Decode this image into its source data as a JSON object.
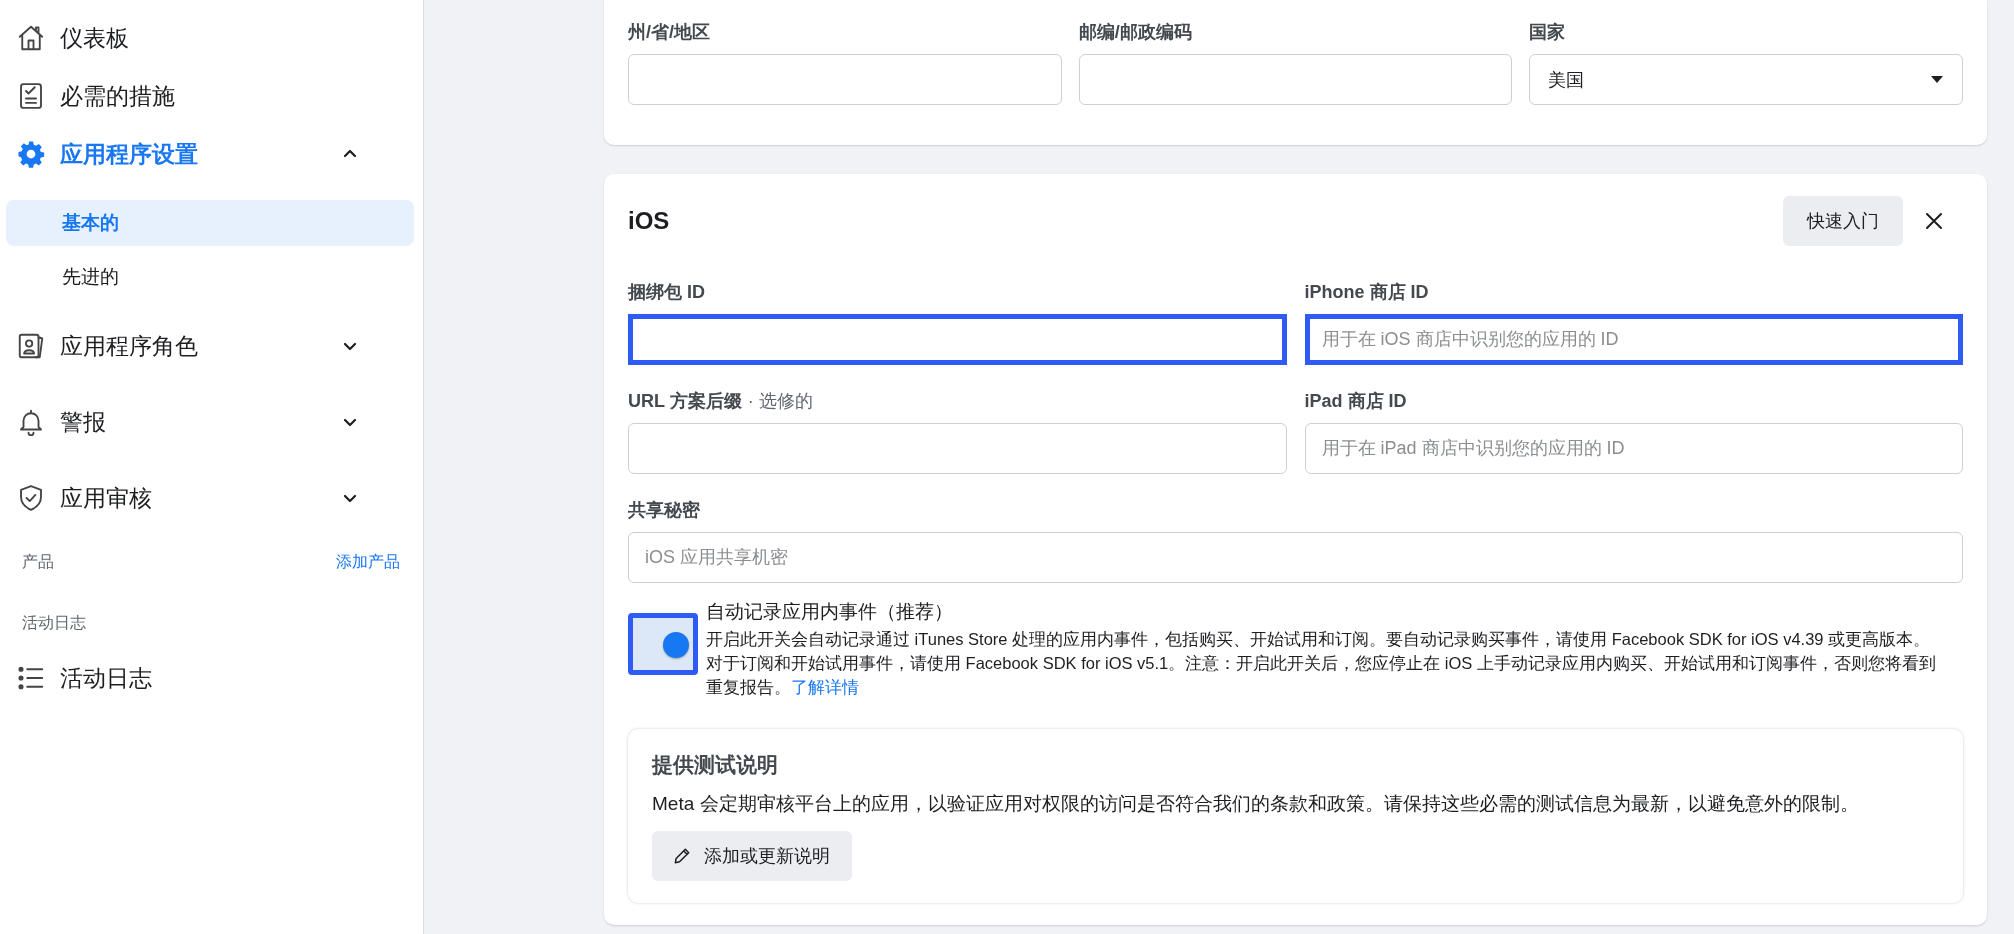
{
  "sidebar": {
    "nav": [
      {
        "label": "仪表板",
        "selected": false
      },
      {
        "label": "必需的措施",
        "selected": false
      },
      {
        "label": "应用程序设置",
        "selected": true,
        "expanded": true,
        "children": [
          {
            "label": "基本的",
            "selected": true
          },
          {
            "label": "先进的",
            "selected": false
          }
        ]
      },
      {
        "label": "应用程序角色",
        "selected": false,
        "expanded": false
      },
      {
        "label": "警报",
        "selected": false,
        "expanded": false
      },
      {
        "label": "应用审核",
        "selected": false,
        "expanded": false
      }
    ],
    "products": {
      "heading": "产品",
      "link": "添加产品"
    },
    "activity": {
      "heading": "活动日志",
      "items": [
        {
          "label": "活动日志",
          "selected": false
        }
      ]
    }
  },
  "address_card": {
    "fields": [
      {
        "kind": "text",
        "label": "州/省/地区"
      },
      {
        "kind": "text",
        "label": "邮编/邮政编码"
      },
      {
        "kind": "select",
        "label": "国家",
        "value": "美国"
      }
    ]
  },
  "ios_card": {
    "title": "iOS",
    "quick_start_button": "快速入门",
    "fields": [
      {
        "label": "捆绑包 ID",
        "highlighted": true
      },
      {
        "label": "iPhone 商店 ID",
        "placeholder": "用于在 iOS 商店中识别您的应用的 ID",
        "highlighted": true
      },
      {
        "label": "URL 方案后缀",
        "note": "· 选修的",
        "highlighted": false
      },
      {
        "label": "iPad 商店 ID",
        "placeholder": "用于在 iPad 商店中识别您的应用的 ID",
        "highlighted": false
      },
      {
        "label": "共享秘密",
        "placeholder": "iOS 应用共享机密",
        "highlighted": false
      }
    ],
    "auto_log": {
      "title": "自动记录应用内事件（推荐）",
      "on": true,
      "highlighted": true,
      "description": "开启此开关会自动记录通过 iTunes Store 处理的应用内事件，包括购买、开始试用和订阅。要自动记录购买事件，请使用 Facebook SDK for iOS v4.39 或更高版本。对于订阅和开始试用事件，请使用 Facebook SDK for iOS v5.1。注意：开启此开关后，您应停止在 iOS 上手动记录应用内购买、开始试用和订阅事件，否则您将看到重复报告。",
      "link": "了解详情"
    },
    "test_instructions": {
      "title": "提供测试说明",
      "description": "Meta 会定期审核平台上的应用，以验证应用对权限的访问是否符合我们的条款和政策。请保持这些必需的测试信息为最新，以避免意外的限制。",
      "button": "添加或更新说明"
    }
  }
}
